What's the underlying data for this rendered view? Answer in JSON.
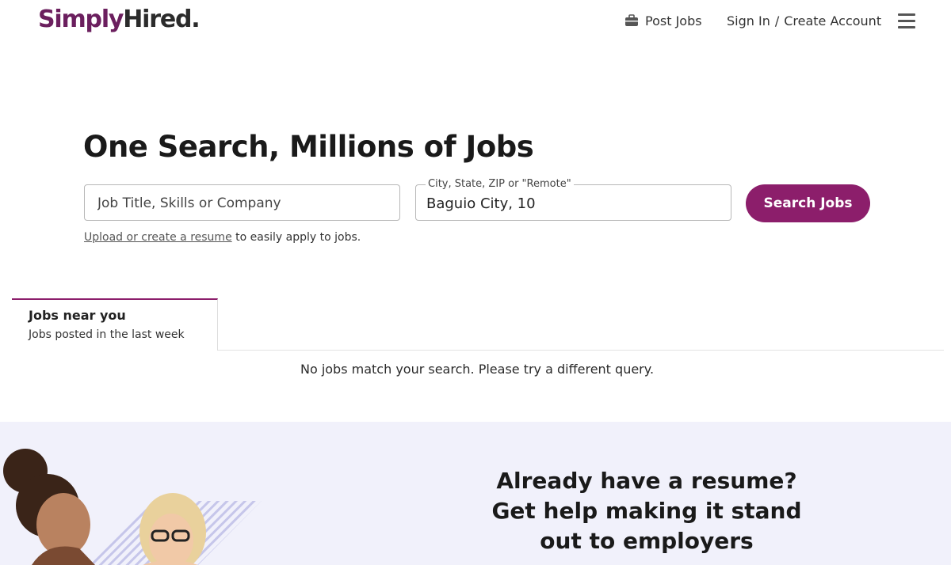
{
  "header": {
    "logo_part1": "Simply",
    "logo_part2": "Hired.",
    "post_jobs": "Post Jobs",
    "sign_in": "Sign In",
    "separator": "/",
    "create_account": "Create Account"
  },
  "hero": {
    "title": "One Search, Millions of Jobs",
    "keyword_placeholder": "Job Title, Skills or Company",
    "location_label": "City, State, ZIP or \"Remote\"",
    "location_value": "Baguio City, 10",
    "search_button": "Search Jobs",
    "resume_link": "Upload or create a resume",
    "resume_suffix": " to easily apply to jobs."
  },
  "tabs": [
    {
      "title": "Jobs near you",
      "subtitle": "Jobs posted in the last week"
    }
  ],
  "results": {
    "empty_message": "No jobs match your search. Please try a different query."
  },
  "resume_band": {
    "line1": "Already have a resume?",
    "line2": "Get help making it stand",
    "line3": "out to employers"
  },
  "colors": {
    "brand": "#8c1e6b",
    "band_bg": "#f1f1fb",
    "logo_dark": "#2b2b2b"
  },
  "icons": [
    "briefcase-icon",
    "hamburger-menu-icon"
  ]
}
